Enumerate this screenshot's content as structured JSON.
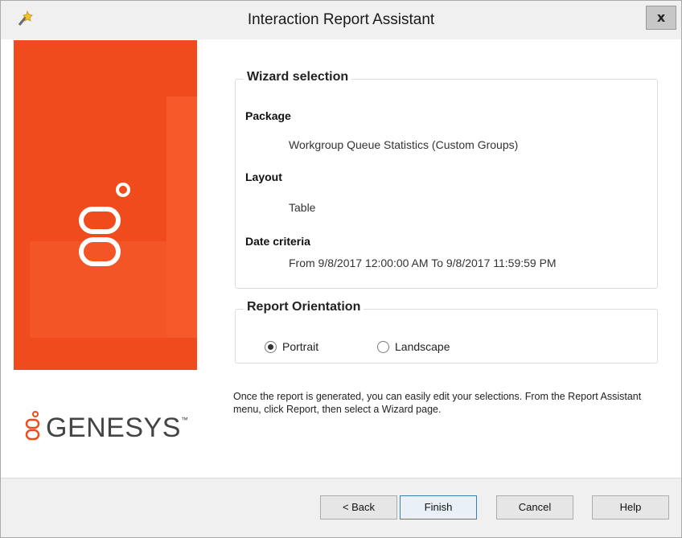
{
  "window": {
    "title": "Interaction Report Assistant",
    "close_label": "x"
  },
  "brand": {
    "name": "GENESYS",
    "trademark": "™",
    "accent_color": "#ef4b1c"
  },
  "wizard_selection": {
    "legend": "Wizard selection",
    "package_label": "Package",
    "package_value": "Workgroup Queue Statistics (Custom Groups)",
    "layout_label": "Layout",
    "layout_value": "Table",
    "date_label": "Date criteria",
    "date_value": "From 9/8/2017 12:00:00 AM To 9/8/2017 11:59:59 PM"
  },
  "orientation": {
    "legend": "Report Orientation",
    "options": [
      {
        "label": "Portrait",
        "selected": true
      },
      {
        "label": "Landscape",
        "selected": false
      }
    ]
  },
  "hint": "Once the report is generated, you can easily edit your selections. From the Report Assistant menu, click Report, then select a Wizard page.",
  "buttons": {
    "back": "< Back",
    "finish": "Finish",
    "cancel": "Cancel",
    "help": "Help"
  },
  "icons": {
    "app": "wizard-wand-icon",
    "brand_mark": "genesys-mark-icon"
  }
}
